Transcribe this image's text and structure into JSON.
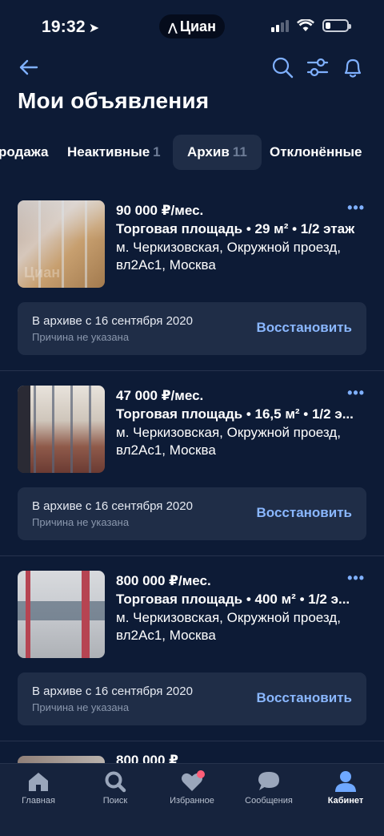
{
  "status_bar": {
    "time": "19:32",
    "app_pill": "Циан",
    "battery_level": 0.25
  },
  "header": {
    "title": "Мои объявления",
    "icons": [
      "back-arrow-icon",
      "search-icon",
      "filter-icon",
      "bell-icon"
    ]
  },
  "tabs": [
    {
      "label": "родажа",
      "count": ""
    },
    {
      "label": "Неактивные",
      "count": "1"
    },
    {
      "label": "Архив",
      "count": "11",
      "active": true
    },
    {
      "label": "Отклонённые",
      "count": ""
    }
  ],
  "listings": [
    {
      "price": "90 000 ₽/мес.",
      "subtitle": "Торговая площадь • 29 м² • 1/2 этаж",
      "address": "м. Черкизовская, Окружной проезд, вл2Ас1, Москва",
      "archive_date": "В архиве с 16 сентября 2020",
      "reason": "Причина не указана",
      "restore_label": "Восстановить",
      "more_label": "•••",
      "watermark": "Циан"
    },
    {
      "price": "47 000 ₽/мес.",
      "subtitle": "Торговая площадь • 16,5 м² • 1/2 э...",
      "address": "м. Черкизовская, Окружной проезд, вл2Ас1, Москва",
      "archive_date": "В архиве с 16 сентября 2020",
      "reason": "Причина не указана",
      "restore_label": "Восстановить",
      "more_label": "•••",
      "watermark": ""
    },
    {
      "price": "800 000 ₽/мес.",
      "subtitle": "Торговая площадь • 400 м² • 1/2 э...",
      "address": "м. Черкизовская, Окружной проезд, вл2Ас1, Москва",
      "archive_date": "В архиве с 16 сентября 2020",
      "reason": "Причина не указана",
      "restore_label": "Восстановить",
      "more_label": "•••",
      "watermark": ""
    }
  ],
  "partial_listing": {
    "price": "800 000 ₽"
  },
  "bottom_nav": [
    {
      "label": "Главная",
      "icon": "home-icon"
    },
    {
      "label": "Поиск",
      "icon": "search-icon"
    },
    {
      "label": "Избранное",
      "icon": "heart-icon",
      "has_badge": true
    },
    {
      "label": "Сообщения",
      "icon": "chat-bubble-icon"
    },
    {
      "label": "Кабинет",
      "icon": "profile-icon",
      "active": true
    }
  ],
  "colors": {
    "background": "#0d1b36",
    "card_surface": "#1f2d47",
    "accent": "#8ab7ff",
    "badge": "#ff5e78"
  }
}
